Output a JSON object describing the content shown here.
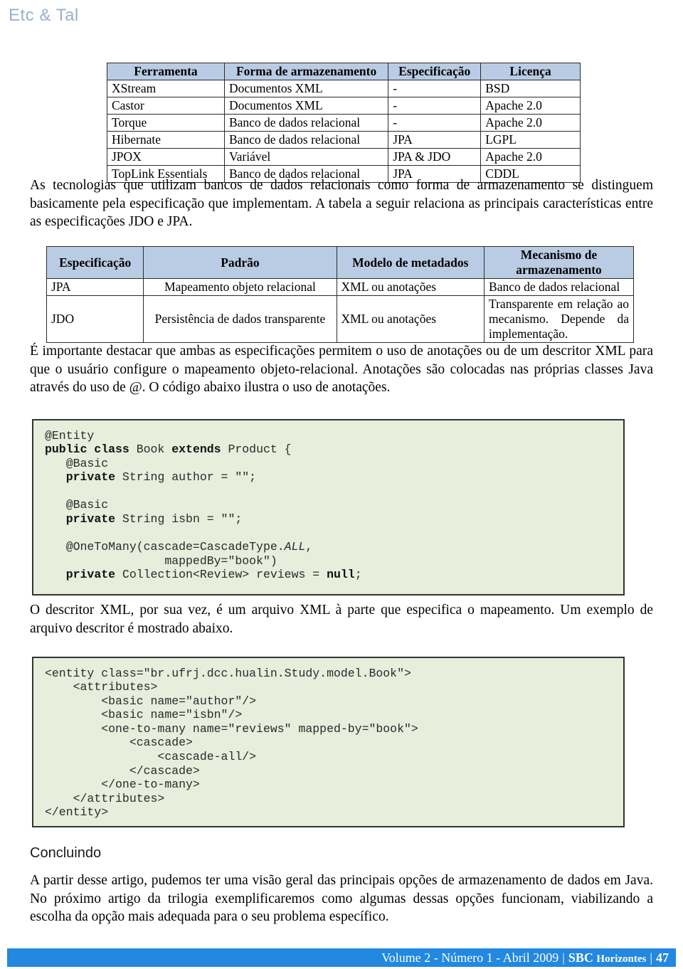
{
  "running_head": "Etc & Tal",
  "tools_table": {
    "headers": [
      "Ferramenta",
      "Forma de armazenamento",
      "Especificação",
      "Licença"
    ],
    "rows": [
      [
        "XStream",
        "Documentos XML",
        "-",
        "BSD"
      ],
      [
        "Castor",
        "Documentos XML",
        "-",
        "Apache 2.0"
      ],
      [
        "Torque",
        "Banco de dados relacional",
        "-",
        "Apache 2.0"
      ],
      [
        "Hibernate",
        "Banco de dados relacional",
        "JPA",
        "LGPL"
      ],
      [
        "JPOX",
        "Variável",
        "JPA & JDO",
        "Apache 2.0"
      ],
      [
        "TopLink Essentials",
        "Banco de dados relacional",
        "JPA",
        "CDDL"
      ]
    ]
  },
  "paragraphs": {
    "tecnologias": "As tecnologias que utilizam bancos de dados relacionais como forma de armazenamento se distinguem basicamente pela especificação que implementam. A tabela a seguir relaciona as principais características entre as especificações JDO e JPA.",
    "importante": "É importante destacar que ambas as especificações permitem o uso de anotações ou de um descritor XML para que o usuário configure o mapeamento objeto-relacional. Anotações são colocadas nas próprias classes Java através do uso de @. O código abaixo ilustra o uso de anotações.",
    "descritor": "O descritor XML, por sua vez, é um arquivo XML à parte que especifica o mapeamento. Um exemplo de arquivo descritor é mostrado abaixo.",
    "conclusao": "A partir desse artigo, pudemos ter uma visão geral das principais opções de armazenamento de dados em Java. No próximo artigo da trilogia exemplificaremos como algumas dessas opções funcionam, viabilizando a escolha da opção mais adequada para o seu problema específico."
  },
  "specs_table": {
    "headers": [
      "Especificação",
      "Padrão",
      "Modelo de metadados",
      "Mecanismo de armazenamento"
    ],
    "rows": [
      [
        "JPA",
        "Mapeamento objeto relacional",
        "XML ou anotações",
        "Banco de dados relacional"
      ],
      [
        "JDO",
        "Persistência de dados transparente",
        "XML ou anotações",
        "Transparente em relação ao mecanismo. Depende da implementação."
      ]
    ]
  },
  "code_java": {
    "language": "java",
    "text": "@Entity\npublic class Book extends Product {\n   @Basic\n   private String author = \"\";\n\n   @Basic\n   private String isbn = \"\";\n\n   @OneToMany(cascade=CascadeType.ALL,\n                 mappedBy=\"book\")\n   private Collection<Review> reviews = null;"
  },
  "code_xml": {
    "language": "xml",
    "text": "<entity class=\"br.ufrj.dcc.hualin.Study.model.Book\">\n    <attributes>\n        <basic name=\"author\"/>\n        <basic name=\"isbn\"/>\n        <one-to-many name=\"reviews\" mapped-by=\"book\">\n            <cascade>\n                <cascade-all/>\n            </cascade>\n        </one-to-many>\n    </attributes>\n</entity>"
  },
  "section_heading": "Concluindo",
  "footer": {
    "issue": "Volume 2 - Número 1 - Abril 2009",
    "separator": "|",
    "brand_first": "SBC",
    "brand_rest": "Horizontes",
    "page_number": "47",
    "bar_color": "#2288e0"
  }
}
